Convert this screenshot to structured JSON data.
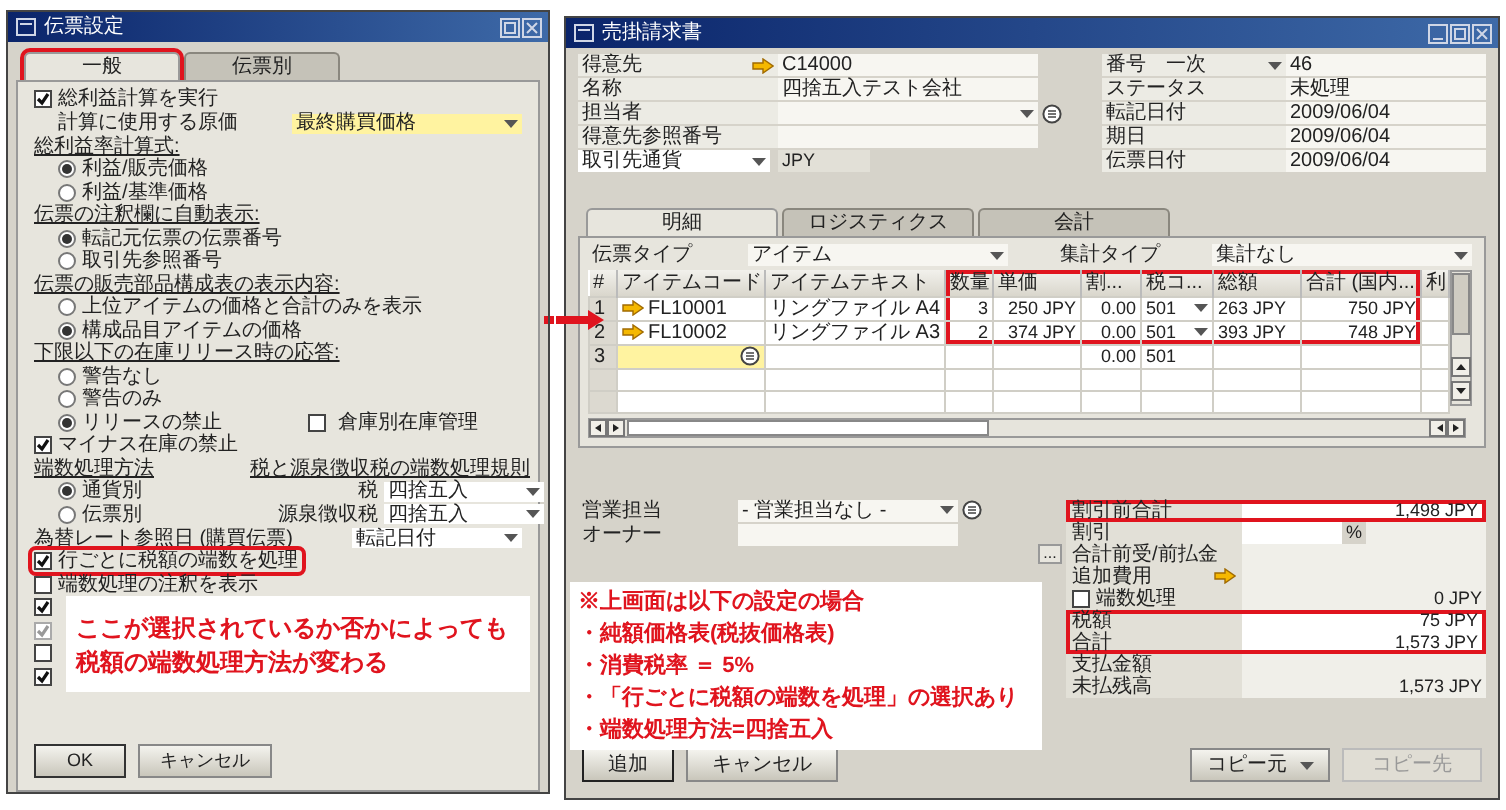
{
  "settings_dialog": {
    "title": "伝票設定",
    "tabs": [
      {
        "label": "一般",
        "selected": true,
        "highlighted": true
      },
      {
        "label": "伝票別",
        "selected": false,
        "highlighted": false
      }
    ],
    "items": [
      {
        "kind": "checkbox",
        "label": "総利益計算を実行",
        "checked": true,
        "disabled": false,
        "highlighted": false,
        "children": [
          {
            "kind": "select",
            "label": "計算に使用する原価",
            "value": "最終購買価格",
            "focused": true
          }
        ]
      },
      {
        "kind": "heading",
        "label": "総利益率計算式:",
        "children": [
          {
            "kind": "radio",
            "label": "利益/販売価格",
            "selected": true
          },
          {
            "kind": "radio",
            "label": "利益/基準価格",
            "selected": false
          }
        ]
      },
      {
        "kind": "heading",
        "label": "伝票の注釈欄に自動表示:",
        "children": [
          {
            "kind": "radio",
            "label": "転記元伝票の伝票番号",
            "selected": true
          },
          {
            "kind": "radio",
            "label": "取引先参照番号",
            "selected": false
          }
        ]
      },
      {
        "kind": "heading",
        "label": "伝票の販売部品構成表の表示内容:",
        "children": [
          {
            "kind": "radio",
            "label": "上位アイテムの価格と合計のみを表示",
            "selected": false
          },
          {
            "kind": "radio",
            "label": "構成品目アイテムの価格",
            "selected": true
          }
        ]
      },
      {
        "kind": "heading",
        "label": "下限以下の在庫リリース時の応答:",
        "children": [
          {
            "kind": "radio",
            "label": "警告なし",
            "selected": false
          },
          {
            "kind": "radio",
            "label": "警告のみ",
            "selected": false
          },
          {
            "kind": "radio",
            "label": "リリースの禁止",
            "selected": true,
            "side": {
              "label": "倉庫別在庫管理",
              "checked": false
            }
          }
        ]
      },
      {
        "kind": "checkbox",
        "label": "マイナス在庫の禁止",
        "checked": true,
        "disabled": false,
        "highlighted": false
      },
      {
        "kind": "columns",
        "columns": [
          {
            "kind": "heading",
            "label": "端数処理方法",
            "children": [
              {
                "kind": "radio",
                "label": "通貨別",
                "selected": true
              },
              {
                "kind": "radio",
                "label": "伝票別",
                "selected": false
              }
            ]
          },
          {
            "kind": "heading",
            "label": "税と源泉徴収税の端数処理規則",
            "children": [
              {
                "kind": "field",
                "label": "税",
                "value": "四捨五入"
              },
              {
                "kind": "field",
                "label": "源泉徴収税",
                "value": "四捨五入"
              }
            ]
          }
        ]
      },
      {
        "kind": "select",
        "label": "為替レート参照日 (購買伝票)",
        "value": "転記日付",
        "focused": false
      },
      {
        "kind": "checkbox",
        "label": "行ごとに税額の端数を処理",
        "checked": true,
        "disabled": false,
        "highlighted": true
      },
      {
        "kind": "checkbox",
        "label": "端数処理の注釈を表示",
        "checked": false,
        "disabled": false,
        "highlighted": false
      },
      {
        "kind": "checkbox",
        "checked": true,
        "disabled": false,
        "highlighted": false
      },
      {
        "kind": "checkbox",
        "checked": true,
        "disabled": true,
        "highlighted": false
      },
      {
        "kind": "checkbox",
        "checked": false,
        "disabled": false,
        "highlighted": false
      },
      {
        "kind": "checkbox",
        "checked": true,
        "disabled": false,
        "highlighted": false
      }
    ],
    "note": [
      "ここが選択されているか否かによっても",
      "税額の端数処理方法が変わる"
    ],
    "buttons": [
      "OK",
      "キャンセル"
    ]
  },
  "invoice_window": {
    "title": "売掛請求書",
    "header_left": [
      {
        "kind": "link",
        "label": "得意先",
        "value": "C14000"
      },
      {
        "kind": "text",
        "label": "名称",
        "value": "四捨五入テスト会社"
      },
      {
        "kind": "select",
        "label": "担当者"
      },
      {
        "kind": "text",
        "label": "得意先参照番号"
      },
      {
        "kind": "currency",
        "label": "取引先通貨",
        "value": "JPY"
      }
    ],
    "header_right": [
      {
        "kind": "series",
        "label": "番号",
        "series": "一次",
        "value": "46"
      },
      {
        "kind": "text",
        "label": "ステータス",
        "value": "未処理"
      },
      {
        "kind": "text",
        "label": "転記日付",
        "value": "2009/06/04"
      },
      {
        "kind": "text",
        "label": "期日",
        "value": "2009/06/04"
      },
      {
        "kind": "text",
        "label": "伝票日付",
        "value": "2009/06/04"
      }
    ],
    "tabs": [
      {
        "label": "明細",
        "selected": true
      },
      {
        "label": "ロジスティクス",
        "selected": false
      },
      {
        "label": "会計",
        "selected": false
      }
    ],
    "document_type": {
      "label": "伝票タイプ",
      "value": "アイテム"
    },
    "summary_type": {
      "label": "集計タイプ",
      "value": "集計なし"
    },
    "table": {
      "columns": [
        {
          "label": "#",
          "highlighted": false
        },
        {
          "label": "アイテムコード",
          "highlighted": false
        },
        {
          "label": "アイテムテキスト",
          "highlighted": false
        },
        {
          "label": "数量",
          "highlighted": true
        },
        {
          "label": "単価",
          "highlighted": true
        },
        {
          "label": "割...",
          "highlighted": true
        },
        {
          "label": "税コ...",
          "highlighted": true
        },
        {
          "label": "総額",
          "highlighted": true
        },
        {
          "label": "合計 (国内...",
          "highlighted": true
        },
        {
          "label": "利",
          "highlighted": false
        }
      ],
      "rows": [
        {
          "cells": [
            "1",
            "FL10001",
            "リングファイル A4",
            "3",
            "250 JPY",
            "0.00",
            "501",
            "263 JPY",
            "750 JPY"
          ],
          "linked": true,
          "editing": false,
          "highlighted": true
        },
        {
          "cells": [
            "2",
            "FL10002",
            "リングファイル A3",
            "2",
            "374 JPY",
            "0.00",
            "501",
            "393 JPY",
            "748 JPY"
          ],
          "linked": true,
          "editing": false,
          "highlighted": true
        },
        {
          "cells": [
            "3",
            null,
            null,
            null,
            null,
            "0.00",
            "501"
          ],
          "linked": false,
          "editing": true,
          "highlighted": false
        }
      ]
    },
    "sales_employee": {
      "label": "営業担当",
      "value": "- 営業担当なし -"
    },
    "owner": {
      "label": "オーナー"
    },
    "totals": [
      {
        "kind": "amount",
        "label": "割引前合計",
        "value": "1,498 JPY",
        "highlighted": true
      },
      {
        "kind": "percent",
        "label": "割引",
        "unit": "%",
        "highlighted": false
      },
      {
        "kind": "amount",
        "label": "合計前受/前払金",
        "button": "...",
        "highlighted": false
      },
      {
        "kind": "link",
        "label": "追加費用",
        "highlighted": false
      },
      {
        "kind": "checkbox",
        "label": "端数処理",
        "checked": false,
        "value": "0 JPY",
        "highlighted": false
      },
      {
        "kind": "amount",
        "label": "税額",
        "value": "75 JPY",
        "highlighted": true
      },
      {
        "kind": "amount",
        "label": "合計",
        "value": "1,573 JPY",
        "highlighted": true
      },
      {
        "kind": "amount",
        "label": "支払金額",
        "highlighted": false
      },
      {
        "kind": "amount",
        "label": "未払残高",
        "value": "1,573 JPY",
        "highlighted": false
      }
    ],
    "note": [
      "※上画面は以下の設定の場合",
      "・純額価格表(税抜価格表)",
      "・消費税率 ＝ 5%",
      "・「行ごとに税額の端数を処理」の選択あり",
      "・端数処理方法=四捨五入"
    ],
    "buttons": [
      {
        "label": "追加",
        "kind": "default"
      },
      {
        "label": "キャンセル",
        "kind": "plain"
      }
    ],
    "copy_buttons": [
      {
        "label": "コピー元",
        "kind": "dropdown",
        "disabled": false
      },
      {
        "label": "コピー先",
        "kind": "plain",
        "disabled": true
      }
    ]
  }
}
